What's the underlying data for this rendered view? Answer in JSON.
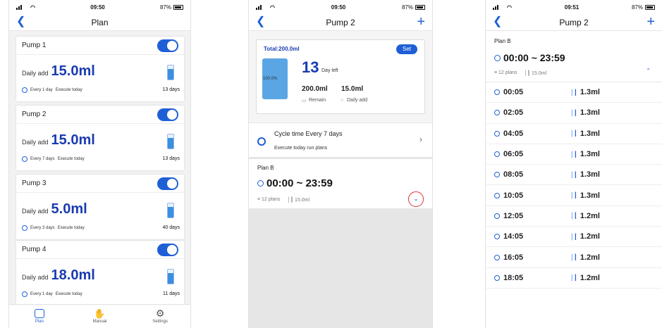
{
  "colors": {
    "accent": "#1f5fd6",
    "value_blue": "#1a3bb0",
    "highlight_red": "#e23030"
  },
  "screen1": {
    "status": {
      "time": "09:50",
      "battery": "87%"
    },
    "nav_title": "Plan",
    "pumps": [
      {
        "name": "Pump 1",
        "daily_label": "Daily add",
        "daily_value": "15.0ml",
        "every": "Every 1 day",
        "execute": "Execute today",
        "days": "13 days",
        "enabled": true
      },
      {
        "name": "Pump 2",
        "daily_label": "Daily add",
        "daily_value": "15.0ml",
        "every": "Every 7 days",
        "execute": "Execute today",
        "days": "13 days",
        "enabled": true
      },
      {
        "name": "Pump 3",
        "daily_label": "Daily add",
        "daily_value": "5.0ml",
        "every": "Every 3 days",
        "execute": "Execute today",
        "days": "40 days",
        "enabled": true
      },
      {
        "name": "Pump 4",
        "daily_label": "Daily add",
        "daily_value": "18.0ml",
        "every": "Every 1 day",
        "execute": "Execute today",
        "days": "11 days",
        "enabled": true
      }
    ],
    "tabs": [
      {
        "label": "Plan",
        "icon": "list-icon",
        "active": true
      },
      {
        "label": "Manual",
        "icon": "hand-icon",
        "active": false
      },
      {
        "label": "Settings",
        "icon": "gear-icon",
        "active": false
      }
    ]
  },
  "screen2": {
    "status": {
      "time": "09:50",
      "battery": "87%"
    },
    "nav_title": "Pump 2",
    "total_label": "Total:200.0ml",
    "set_label": "Set",
    "tank_percent": "100.0%",
    "days_left_num": "13",
    "days_left_label": "Day left",
    "remain_value": "200.0ml",
    "remain_label": "Remain",
    "daily_value": "15.0ml",
    "daily_label": "Daily add",
    "cycle_text": "Cycle time   Every 7 days",
    "cycle_sub": "Execute today run plans",
    "plan_name": "Plan B",
    "plan_time": "00:00 ~ 23:59",
    "plan_count": "12 plans",
    "plan_volume": "15.0ml"
  },
  "screen3": {
    "status": {
      "time": "09:51",
      "battery": "87%"
    },
    "nav_title": "Pump 2",
    "plan_name": "Plan B",
    "plan_time": "00:00 ~ 23:59",
    "plan_count": "12 plans",
    "plan_volume": "15.0ml",
    "rows": [
      {
        "time": "00:05",
        "volume": "1.3ml"
      },
      {
        "time": "02:05",
        "volume": "1.3ml"
      },
      {
        "time": "04:05",
        "volume": "1.3ml"
      },
      {
        "time": "06:05",
        "volume": "1.3ml"
      },
      {
        "time": "08:05",
        "volume": "1.3ml"
      },
      {
        "time": "10:05",
        "volume": "1.3ml"
      },
      {
        "time": "12:05",
        "volume": "1.2ml"
      },
      {
        "time": "14:05",
        "volume": "1.2ml"
      },
      {
        "time": "16:05",
        "volume": "1.2ml"
      },
      {
        "time": "18:05",
        "volume": "1.2ml"
      }
    ]
  }
}
